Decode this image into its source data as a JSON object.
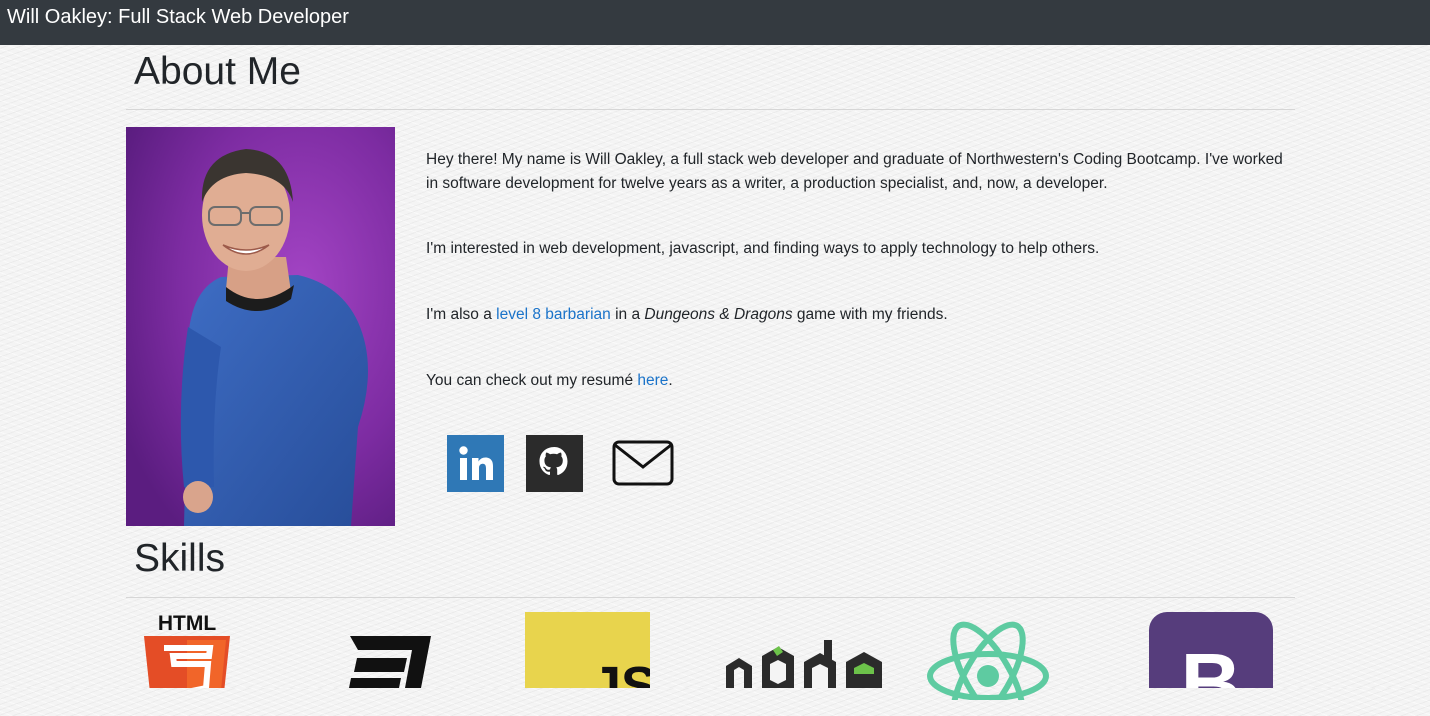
{
  "navbar": {
    "brand": "Will Oakley: Full Stack Web Developer"
  },
  "about": {
    "title": "About Me",
    "photo_alt": "Will Oakley",
    "paragraph1": "Hey there! My name is Will Oakley, a full stack web developer and graduate of Northwestern's Coding Bootcamp. I've worked in software development for twelve years as a writer, a production specialist, and, now, a developer.",
    "paragraph2": "I'm interested in web development, javascript, and finding ways to apply technology to help others.",
    "paragraph3": {
      "before": "I'm also a ",
      "link": "level 8 barbarian",
      "middle": " in a ",
      "italic": "Dungeons & Dragons",
      "after": " game with my friends."
    },
    "paragraph4": {
      "before": "You can check out my resumé ",
      "link": "here",
      "after": "."
    },
    "social": [
      {
        "name": "LinkedIn",
        "icon": "linkedin-icon",
        "color": "#2f78b6"
      },
      {
        "name": "GitHub",
        "icon": "github-icon",
        "color": "#2b2b2b"
      },
      {
        "name": "Email",
        "icon": "mail-icon",
        "color": "#111111"
      }
    ]
  },
  "skills": {
    "title": "Skills",
    "logos": [
      {
        "icon": "html5-icon",
        "label": "HTML",
        "color": "#e44d26"
      },
      {
        "icon": "css3-icon",
        "color": "#111111"
      },
      {
        "icon": "javascript-icon",
        "label": "JS",
        "color": "#e8d44d"
      },
      {
        "icon": "nodejs-icon",
        "label": "node",
        "color": "#2b2b2b"
      },
      {
        "icon": "react-icon",
        "color": "#5ecba1"
      },
      {
        "icon": "bootstrap-icon",
        "label": "B",
        "color": "#563d7c"
      }
    ]
  }
}
